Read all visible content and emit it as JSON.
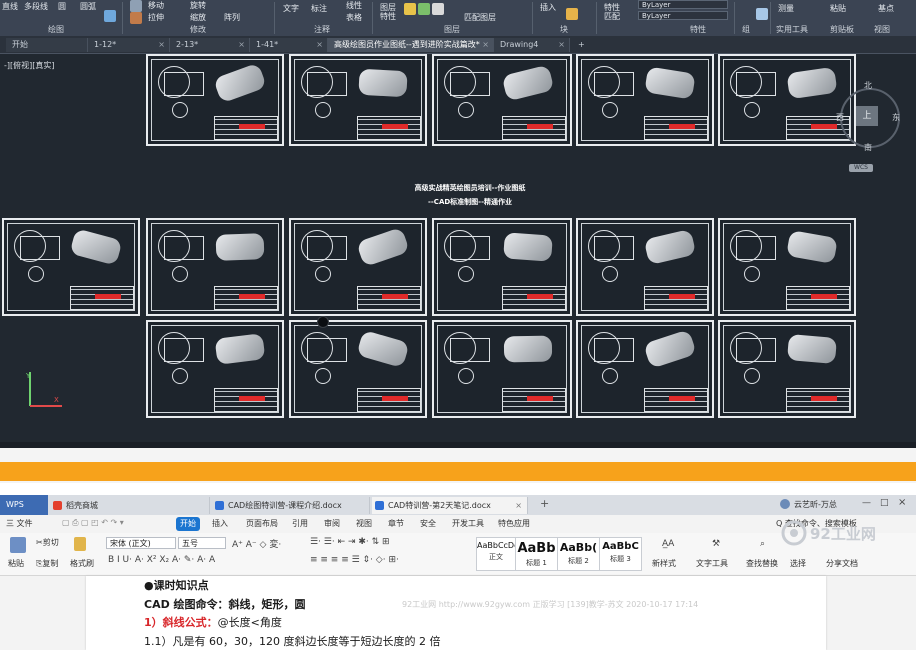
{
  "cad": {
    "ribbon": {
      "top_items": [
        "直线",
        "多段线",
        "圆",
        "圆弧",
        "移动",
        "旋转",
        "修剪",
        "拉伸",
        "缩放",
        "阵列",
        "文字",
        "标注",
        "线性",
        "表格",
        "图层特性",
        "匹配图层",
        "插入",
        "特性匹配",
        "ByLayer",
        "ByLayer",
        "组",
        "测量",
        "粘贴",
        "基点"
      ],
      "panels": [
        "绘图",
        "修改",
        "注释",
        "图层",
        "块",
        "特性",
        "组",
        "实用工具",
        "剪贴板",
        "视图"
      ]
    },
    "doc_tabs": [
      {
        "label": "开始",
        "active": false
      },
      {
        "label": "1-12*",
        "active": false
      },
      {
        "label": "2-13*",
        "active": false
      },
      {
        "label": "1-41*",
        "active": false
      },
      {
        "label": "高级绘图员作业图纸--遇到进阶实战篇改*",
        "active": true
      },
      {
        "label": "Drawing4",
        "active": false
      }
    ],
    "add_tab": "+",
    "viewport_label": "-][俯视][真实]",
    "center_title_1": "高级实战精英绘图员培训--作业图纸",
    "center_title_2": "--CAD标准制图--精通作业",
    "viewcube": {
      "north": "北",
      "east": "东",
      "south": "南",
      "west": "西",
      "top": "上",
      "wcs": "WCS"
    }
  },
  "wps": {
    "tabs": [
      {
        "label": "WPS",
        "active": false
      },
      {
        "label": "稻壳商城",
        "active": false
      },
      {
        "label": "CAD绘图特训营-课程介绍.docx",
        "active": false
      },
      {
        "label": "CAD特训营-第2天笔记.docx",
        "active": true
      }
    ],
    "user": "云艺昕-万总",
    "menu": {
      "file": "三 文件",
      "items": [
        "开始",
        "插入",
        "页面布局",
        "引用",
        "审阅",
        "视图",
        "章节",
        "安全",
        "开发工具",
        "特色应用"
      ],
      "search": "Q 查找命令、搜索模板"
    },
    "toolbar": {
      "paste": "粘贴",
      "cut": "剪切",
      "copy": "复制",
      "format_painter": "格式刷",
      "font": "宋体 (正文)",
      "size": "五号",
      "styles": [
        {
          "sample": "AaBbCcDd",
          "label": "正文"
        },
        {
          "sample": "AaBb",
          "label": "标题 1"
        },
        {
          "sample": "AaBb(",
          "label": "标题 2"
        },
        {
          "sample": "AaBbC",
          "label": "标题 3"
        }
      ],
      "new_style": "新样式",
      "text_tool": "文字工具",
      "find_replace": "查找替换",
      "select": "选择",
      "share": "分享文档"
    },
    "document": {
      "line1": "●课时知识点",
      "line2": "CAD 绘图命令：斜线，矩形，圆",
      "line3_red": "1）斜线公式：",
      "line3_rest": "@长度<角度",
      "line4": "1.1）凡是有 60，30，120 度斜边长度等于短边长度的 2 倍"
    },
    "watermark": "92工业网 http://www.92gyw.com 正版学习 [139]教学-苏文 2020-10-17 17:14",
    "brand": "92工业网"
  },
  "colors": {
    "cad_bg": "#212830",
    "ribbon_bg": "#3b4453",
    "orange_bar": "#f7a21b",
    "wps_start": "#1b75d0",
    "accent_red": "#d8262a"
  }
}
